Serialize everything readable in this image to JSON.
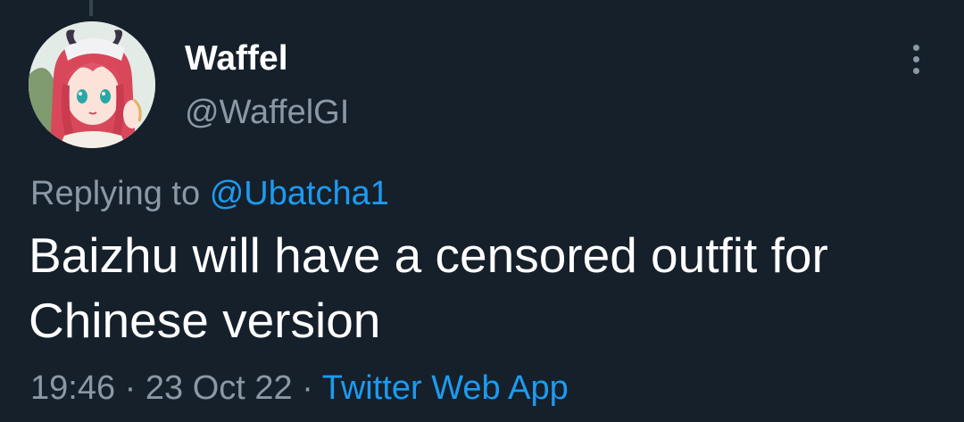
{
  "author": {
    "display_name": "Waffel",
    "handle": "@WaffelGI",
    "avatar_icon": "anime-character-avatar"
  },
  "reply": {
    "prefix": "Replying to",
    "mention": "@Ubatcha1"
  },
  "tweet": {
    "text": "Baizhu will have a censored outfit for Chinese version"
  },
  "meta": {
    "time": "19:46",
    "separator1": " · ",
    "date": "23 Oct 22",
    "separator2": " · ",
    "source": "Twitter Web App"
  },
  "menu": {
    "icon": "more-options-icon"
  },
  "colors": {
    "background": "#15202b",
    "primary_text": "#ffffff",
    "secondary_text": "#8b98a5",
    "accent": "#1d9bf0"
  }
}
